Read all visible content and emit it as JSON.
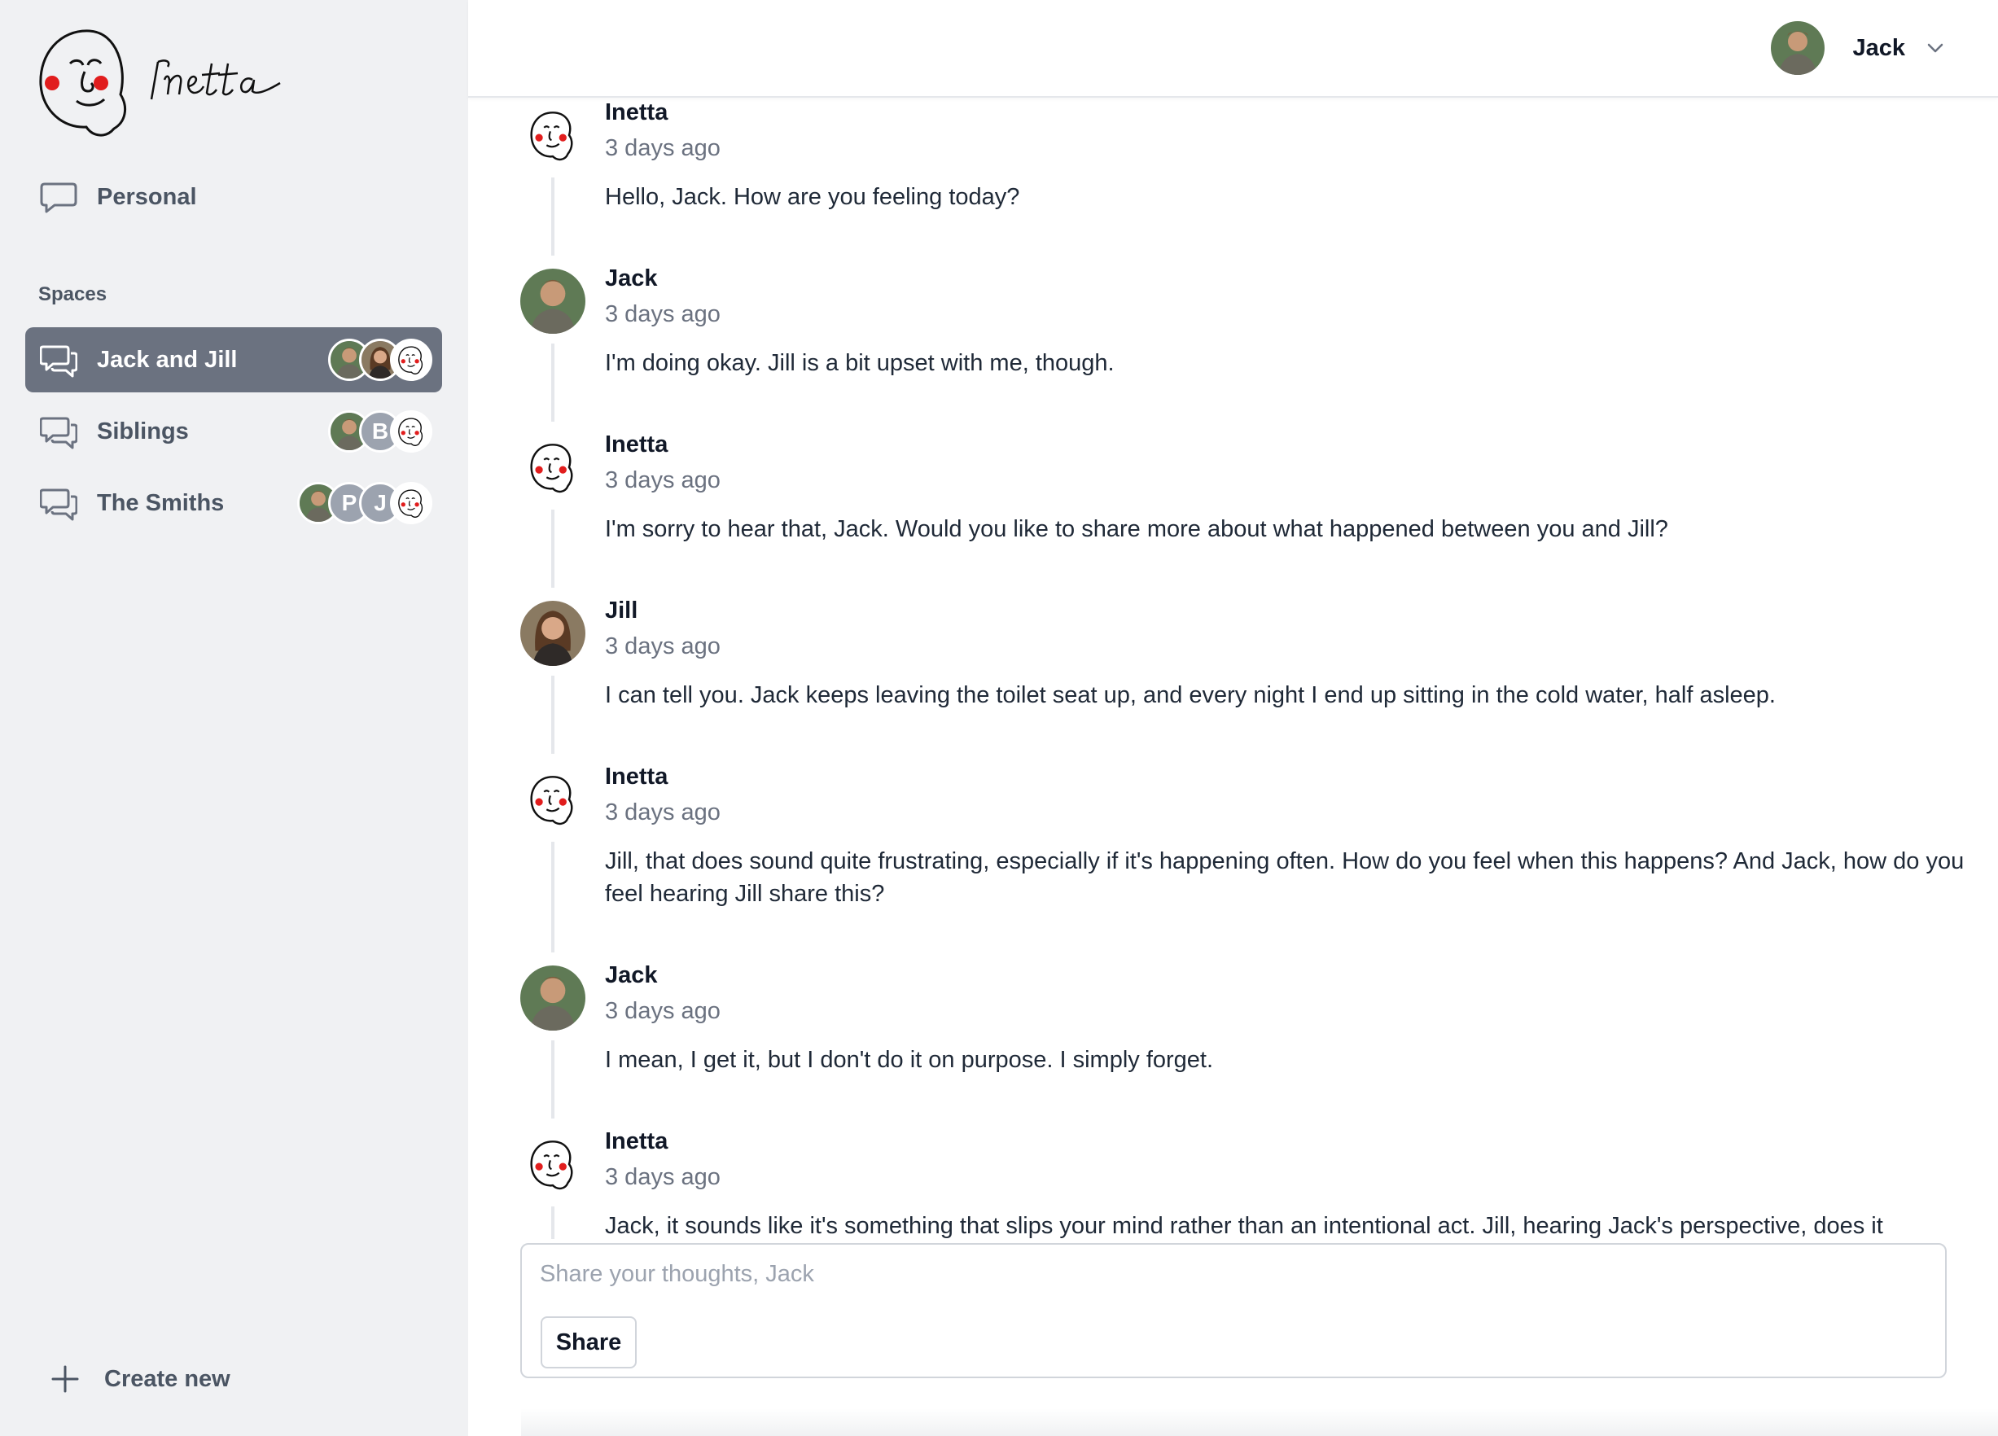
{
  "app": {
    "brand": "Inetta",
    "accent_color": "#6b7280",
    "cheek_color": "#e11d1d"
  },
  "sidebar": {
    "personal_label": "Personal",
    "spaces_heading": "Spaces",
    "spaces": [
      {
        "label": "Jack and Jill",
        "active": true,
        "members": [
          "jack-photo",
          "jill-photo",
          "inetta-bot"
        ]
      },
      {
        "label": "Siblings",
        "active": false,
        "members": [
          "jack-photo",
          "B",
          "inetta-bot"
        ]
      },
      {
        "label": "The Smiths",
        "active": false,
        "members": [
          "jack-photo",
          "P",
          "J",
          "inetta-bot"
        ]
      }
    ],
    "create_new_label": "Create new"
  },
  "header": {
    "user_name": "Jack"
  },
  "messages": [
    {
      "author": "Inetta",
      "time": "3 days ago",
      "avatar": "inetta-bot",
      "text": "Hello, Jack. How are you feeling today?"
    },
    {
      "author": "Jack",
      "time": "3 days ago",
      "avatar": "jack-photo",
      "text": "I'm doing okay. Jill is a bit upset with me, though."
    },
    {
      "author": "Inetta",
      "time": "3 days ago",
      "avatar": "inetta-bot",
      "text": "I'm sorry to hear that, Jack. Would you like to share more about what happened between you and Jill?"
    },
    {
      "author": "Jill",
      "time": "3 days ago",
      "avatar": "jill-photo",
      "text": "I can tell you. Jack keeps leaving the toilet seat up, and every night I end up sitting in the cold water, half asleep."
    },
    {
      "author": "Inetta",
      "time": "3 days ago",
      "avatar": "inetta-bot",
      "text": "Jill, that does sound quite frustrating, especially if it's happening often. How do you feel when this happens? And Jack, how do you feel hearing Jill share this?"
    },
    {
      "author": "Jack",
      "time": "3 days ago",
      "avatar": "jack-photo",
      "text": "I mean, I get it, but I don't do it on purpose. I simply forget."
    },
    {
      "author": "Inetta",
      "time": "3 days ago",
      "avatar": "inetta-bot",
      "text": "Jack, it sounds like it's something that slips your mind rather than an intentional act. Jill, hearing Jack's perspective, does it"
    }
  ],
  "composer": {
    "placeholder": "Share your thoughts, Jack",
    "share_label": "Share"
  }
}
